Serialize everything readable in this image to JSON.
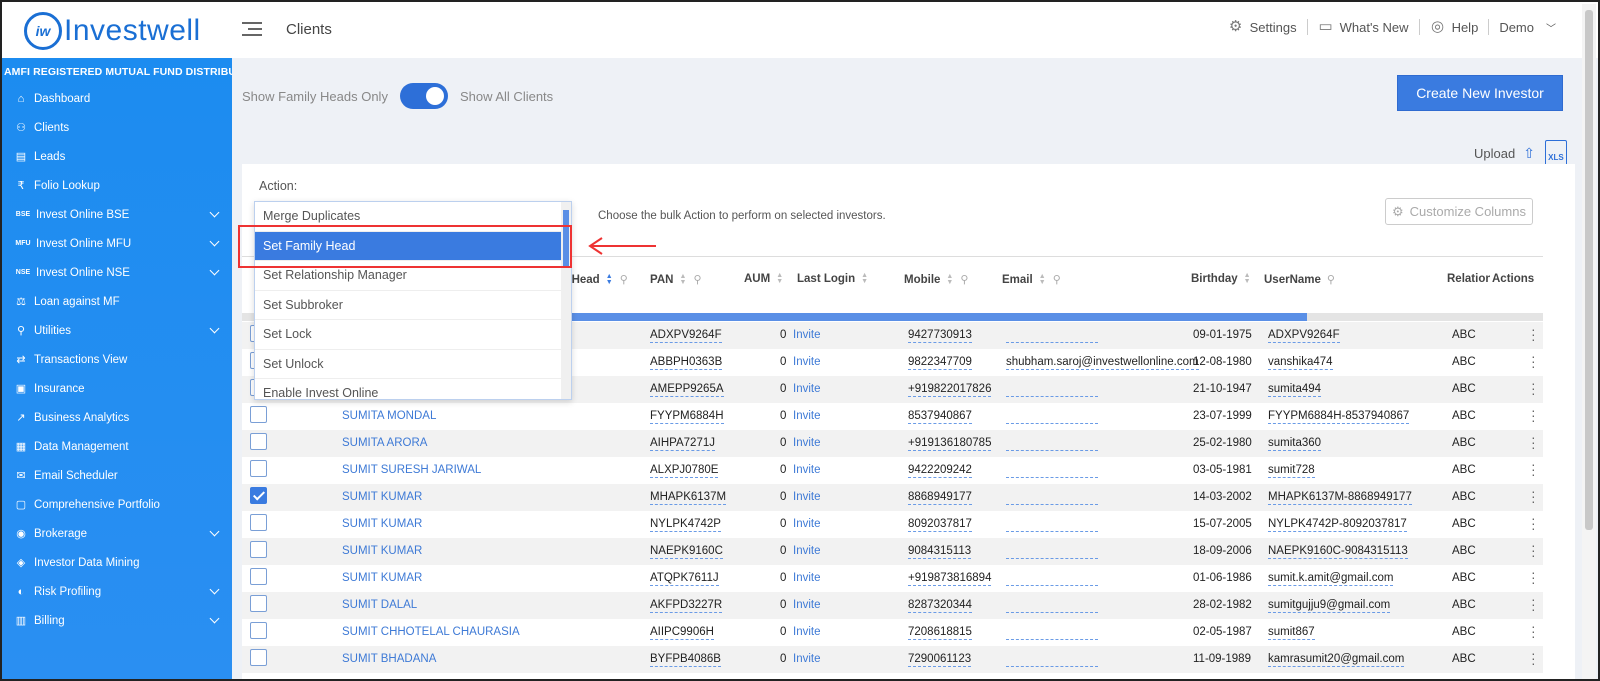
{
  "header": {
    "logo_text": "Investwell",
    "logo_mark": "iw",
    "page_title": "Clients",
    "settings": "Settings",
    "whats_new": "What's New",
    "help": "Help",
    "user": "Demo"
  },
  "sidebar": {
    "tagline": "AMFI REGISTERED MUTUAL FUND DISTRIBUTOR",
    "items": [
      {
        "label": "Dashboard",
        "icon": "home-icon",
        "expandable": false
      },
      {
        "label": "Clients",
        "icon": "users-icon",
        "expandable": false
      },
      {
        "label": "Leads",
        "icon": "leads-icon",
        "expandable": false
      },
      {
        "label": "Folio Lookup",
        "icon": "folio-icon",
        "expandable": false
      },
      {
        "label": "Invest Online BSE",
        "icon": "bse-icon",
        "badge": "BSE",
        "expandable": true
      },
      {
        "label": "Invest Online MFU",
        "icon": "mfu-icon",
        "badge": "MFU",
        "expandable": true
      },
      {
        "label": "Invest Online NSE",
        "icon": "nse-icon",
        "badge": "NSE",
        "expandable": true
      },
      {
        "label": "Loan against MF",
        "icon": "loan-icon",
        "expandable": false
      },
      {
        "label": "Utilities",
        "icon": "utilities-icon",
        "expandable": true
      },
      {
        "label": "Transactions View",
        "icon": "transactions-icon",
        "expandable": false
      },
      {
        "label": "Insurance",
        "icon": "insurance-icon",
        "expandable": false
      },
      {
        "label": "Business Analytics",
        "icon": "analytics-icon",
        "expandable": false
      },
      {
        "label": "Data Management",
        "icon": "data-icon",
        "expandable": false
      },
      {
        "label": "Email Scheduler",
        "icon": "email-icon",
        "expandable": false
      },
      {
        "label": "Comprehensive Portfolio",
        "icon": "portfolio-icon",
        "expandable": false
      },
      {
        "label": "Brokerage",
        "icon": "brokerage-icon",
        "expandable": true
      },
      {
        "label": "Investor Data Mining",
        "icon": "mining-icon",
        "expandable": false
      },
      {
        "label": "Risk Profiling",
        "icon": "risk-icon",
        "expandable": true
      },
      {
        "label": "Billing",
        "icon": "billing-icon",
        "expandable": true
      }
    ]
  },
  "filters": {
    "left_label": "Show Family Heads Only",
    "right_label": "Show All Clients",
    "toggle_on": true
  },
  "buttons": {
    "create": "Create New Investor",
    "upload": "Upload",
    "xls": "XLS",
    "customize": "Customize Columns"
  },
  "action": {
    "label": "Action:",
    "hint": "Choose the bulk Action to perform on selected investors.",
    "options": [
      "Merge Duplicates",
      "Set Family Head",
      "Set Relationship Manager",
      "Set Subbroker",
      "Set Lock",
      "Set Unlock",
      "Enable Invest Online"
    ],
    "selected": "Set Family Head"
  },
  "table": {
    "columns": {
      "family_head": "y Head",
      "pan": "PAN",
      "aum": "AUM",
      "last_login": "Last Login",
      "mobile": "Mobile",
      "email": "Email",
      "birthday": "Birthday",
      "username": "UserName",
      "relation": "Relation:",
      "actions": "Actions"
    },
    "rows": [
      {
        "checked": false,
        "name": "",
        "pan": "ADXPV9264F",
        "aum": "0",
        "login": "Invite",
        "mobile": "9427730913",
        "email": "",
        "birthday": "09-01-1975",
        "username": "ADXPV9264F",
        "relation": "ABC"
      },
      {
        "checked": false,
        "name": "",
        "pan": "ABBPH0363B",
        "aum": "0",
        "login": "Invite",
        "mobile": "9822347709",
        "email": "shubham.saroj@investwellonline.com",
        "birthday": "12-08-1980",
        "username": "vanshika474",
        "relation": "ABC"
      },
      {
        "checked": false,
        "name": "",
        "pan": "AMEPP9265A",
        "aum": "0",
        "login": "Invite",
        "mobile": "+919822017826",
        "email": "",
        "birthday": "21-10-1947",
        "username": "sumita494",
        "relation": "ABC"
      },
      {
        "checked": false,
        "name": "SUMITA MONDAL",
        "pan": "FYYPM6884H",
        "aum": "0",
        "login": "Invite",
        "mobile": "8537940867",
        "email": "",
        "birthday": "23-07-1999",
        "username": "FYYPM6884H-8537940867",
        "relation": "ABC"
      },
      {
        "checked": false,
        "name": "SUMITA ARORA",
        "pan": "AIHPA7271J",
        "aum": "0",
        "login": "Invite",
        "mobile": "+919136180785",
        "email": "",
        "birthday": "25-02-1980",
        "username": "sumita360",
        "relation": "ABC"
      },
      {
        "checked": false,
        "name": "SUMIT SURESH JARIWAL",
        "pan": "ALXPJ0780E",
        "aum": "0",
        "login": "Invite",
        "mobile": "9422209242",
        "email": "",
        "birthday": "03-05-1981",
        "username": "sumit728",
        "relation": "ABC"
      },
      {
        "checked": true,
        "name": "SUMIT KUMAR",
        "pan": "MHAPK6137M",
        "aum": "0",
        "login": "Invite",
        "mobile": "8868949177",
        "email": "",
        "birthday": "14-03-2002",
        "username": "MHAPK6137M-8868949177",
        "relation": "ABC"
      },
      {
        "checked": false,
        "name": "SUMIT KUMAR",
        "pan": "NYLPK4742P",
        "aum": "0",
        "login": "Invite",
        "mobile": "8092037817",
        "email": "",
        "birthday": "15-07-2005",
        "username": "NYLPK4742P-8092037817",
        "relation": "ABC"
      },
      {
        "checked": false,
        "name": "SUMIT KUMAR",
        "pan": "NAEPK9160C",
        "aum": "0",
        "login": "Invite",
        "mobile": "9084315113",
        "email": "",
        "birthday": "18-09-2006",
        "username": "NAEPK9160C-9084315113",
        "relation": "ABC"
      },
      {
        "checked": false,
        "name": "SUMIT KUMAR",
        "pan": "ATQPK7611J",
        "aum": "0",
        "login": "Invite",
        "mobile": "+919873816894",
        "email": "",
        "birthday": "01-06-1986",
        "username": "sumit.k.amit@gmail.com",
        "relation": "ABC"
      },
      {
        "checked": false,
        "name": "SUMIT DALAL",
        "pan": "AKFPD3227R",
        "aum": "0",
        "login": "Invite",
        "mobile": "8287320344",
        "email": "",
        "birthday": "28-02-1982",
        "username": "sumitgujju9@gmail.com",
        "relation": "ABC"
      },
      {
        "checked": false,
        "name": "SUMIT CHHOTELAL CHAURASIA",
        "pan": "AIIPC9906H",
        "aum": "0",
        "login": "Invite",
        "mobile": "7208618815",
        "email": "",
        "birthday": "02-05-1987",
        "username": "sumit867",
        "relation": "ABC"
      },
      {
        "checked": false,
        "name": "SUMIT BHADANA",
        "pan": "BYFPB4086B",
        "aum": "0",
        "login": "Invite",
        "mobile": "7290061123",
        "email": "",
        "birthday": "11-09-1989",
        "username": "kamrasumit20@gmail.com",
        "relation": "ABC"
      }
    ]
  },
  "colors": {
    "brand": "#1a6fd4",
    "sidebar": "#1c8cf0",
    "accent": "#3a7be0",
    "highlight": "#e33333"
  }
}
